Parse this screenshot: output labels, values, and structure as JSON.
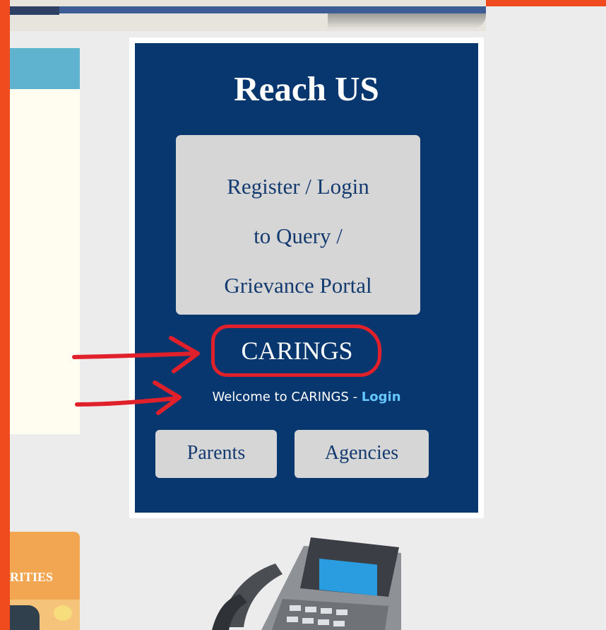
{
  "reach": {
    "title": "Reach US",
    "portal_lines": [
      "Register / Login",
      "to Query /",
      "Grievance Portal"
    ],
    "caring_title": "CARINGS",
    "welcome_text": "Welcome to CARINGS - ",
    "login_link": "Login",
    "buttons": {
      "parents": "Parents",
      "agencies": "Agencies"
    }
  },
  "left_card": {
    "label": "RITIES"
  },
  "icons": {
    "arrow1": "red-arrow-icon",
    "arrow2": "red-arrow-icon",
    "phone": "telephone-icon"
  },
  "colors": {
    "panel": "#07376e",
    "button": "#d6d6d6",
    "annotation": "#e0202a",
    "login_link": "#66c7ff"
  }
}
